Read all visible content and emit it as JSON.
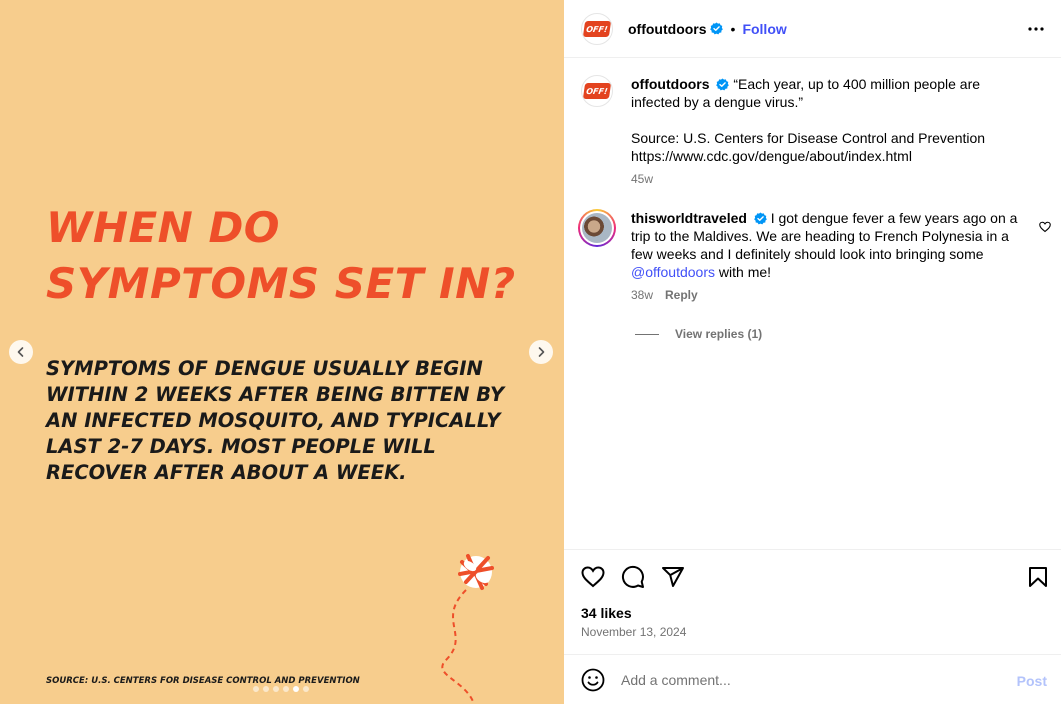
{
  "media": {
    "headline": "When do symptoms set in?",
    "body": "Symptoms of dengue usually begin within 2 weeks after being bitten by an infected mosquito, and typically last 2-7 days. Most people will recover after about a week.",
    "source": "Source: U.S. Centers for Disease Control and Prevention",
    "slide_count": 6,
    "active_slide": 5,
    "background_color": "#f7cd8d",
    "accent_color": "#ee4f2a"
  },
  "header": {
    "username": "offoutdoors",
    "logo_text": "OFF!",
    "separator": "•",
    "follow_label": "Follow"
  },
  "caption": {
    "username": "offoutdoors",
    "text_line1": "“Each year, up to 400 million people are infected by a dengue virus.”",
    "source_line": "Source: U.S. Centers for Disease Control and Prevention",
    "url_line": "https://www.cdc.gov/dengue/about/index.html",
    "time": "45w"
  },
  "comment": {
    "username": "thisworldtraveled",
    "text": "I got dengue fever a few years ago on a trip to the Maldives. We are heading to French Polynesia in a few weeks and I definitely should look into bringing some",
    "mention": "@offoutdoors",
    "text_end": "with me!",
    "time": "38w",
    "reply_label": "Reply",
    "view_replies": "View replies (1)"
  },
  "actions": {
    "icons": [
      "heart-icon",
      "comment-icon",
      "share-icon",
      "bookmark-icon"
    ],
    "likes": "34 likes",
    "date": "November 13, 2024"
  },
  "add_comment": {
    "placeholder": "Add a comment...",
    "post_label": "Post"
  },
  "colors": {
    "link": "#4150f7",
    "verified": "#0095f6",
    "muted": "#737373"
  }
}
